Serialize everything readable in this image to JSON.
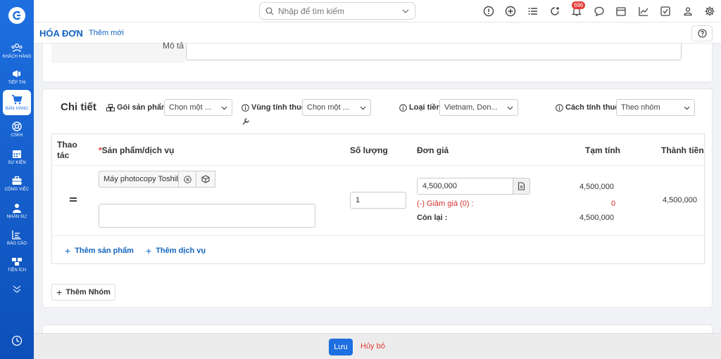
{
  "sidebar": {
    "items": [
      {
        "label": "KHÁCH HÀNG",
        "icon": "users-icon"
      },
      {
        "label": "TIẾP THỊ",
        "icon": "megaphone-icon"
      },
      {
        "label": "BÁN HÀNG",
        "icon": "cart-icon",
        "active": true
      },
      {
        "label": "CSKH",
        "icon": "support-icon"
      },
      {
        "label": "SỰ KIỆN",
        "icon": "calendar-icon"
      },
      {
        "label": "CÔNG VIỆC",
        "icon": "briefcase-icon"
      },
      {
        "label": "NHÂN SỰ",
        "icon": "person-icon"
      },
      {
        "label": "BÁO CÁO",
        "icon": "report-icon"
      },
      {
        "label": "TIỆN ÍCH",
        "icon": "boxes-icon"
      }
    ]
  },
  "topbar": {
    "search_placeholder": "Nhập để tìm kiếm",
    "notification_count": "696"
  },
  "breadcrumb": {
    "title": "HÓA ĐƠN",
    "separator": "›",
    "current": "Thêm mới"
  },
  "upper": {
    "description_label": "Mô tả"
  },
  "detail": {
    "title": "Chi tiết",
    "product_package_label": "Gói sản phẩm",
    "product_package_value": "Chọn một ...",
    "tax_region_label": "Vùng tính thuế",
    "tax_region_value": "Chọn một ...",
    "currency_label": "Loại tiền",
    "currency_value": "Vietnam, Don...",
    "tax_method_label": "Cách tính thuế",
    "tax_method_value": "Theo nhóm"
  },
  "table": {
    "headers": {
      "action_1": "Thao",
      "action_2": "tác",
      "required_mark": "*",
      "product": "Sản phẩm/dịch vụ",
      "quantity": "Số lượng",
      "unit_price": "Đơn giá",
      "subtotal": "Tạm tính",
      "total": "Thành tiền"
    },
    "row": {
      "product": "Máy photocopy Toshiba",
      "quantity": "1",
      "unit_price": "4,500,000",
      "subtotal": "4,500,000",
      "discount_label": "(-) Giảm giá (0) :",
      "discount_value": "0",
      "remaining_label": "Còn lại :",
      "remaining_value": "4,500,000",
      "total": "4,500,000"
    },
    "add_product": "Thêm sản phẩm",
    "add_service": "Thêm dịch vụ"
  },
  "add_group": "Thêm Nhóm",
  "footer": {
    "save": "Lưu",
    "cancel": "Hủy bỏ"
  },
  "colors": {
    "brand": "#1e6fe0",
    "link": "#1565c0",
    "danger": "#e53935"
  }
}
